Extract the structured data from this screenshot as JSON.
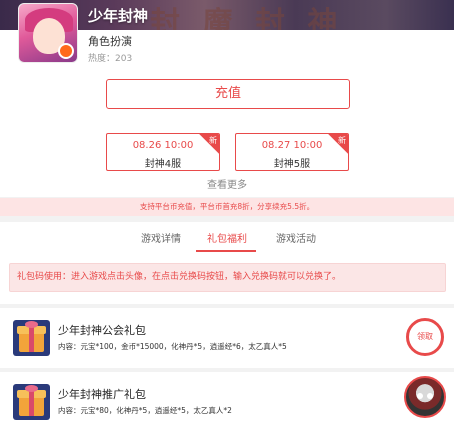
{
  "app": {
    "title": "少年封神",
    "genre": "角色扮演",
    "heat": "热度：203",
    "banner_deco": "封 魔 封 神"
  },
  "actions": {
    "recharge_label": "充值"
  },
  "servers": [
    {
      "time": "08.26 10:00",
      "name": "封神4服",
      "tag": "新"
    },
    {
      "time": "08.27 10:00",
      "name": "封神5服",
      "tag": "新"
    }
  ],
  "more_label": "查看更多",
  "notice": "支持平台币充值，平台币首充8折，分享续充5.5折。",
  "tabs": [
    {
      "label": "游戏详情",
      "active": false
    },
    {
      "label": "礼包福利",
      "active": true
    },
    {
      "label": "游戏活动",
      "active": false
    }
  ],
  "giftcode_tip": "礼包码使用：进入游戏点击头像，在点击兑换码按钮，输入兑换码就可以兑换了。",
  "gifts": [
    {
      "name": "少年封神公会礼包",
      "content": "内容：元宝*100，金币*15000，化神丹*5，逍遥经*6，太乙真人*5",
      "claim_label": "领取"
    },
    {
      "name": "少年封神推广礼包",
      "content": "内容：元宝*80，化神丹*5，逍遥经*5，太乙真人*2"
    }
  ],
  "colors": {
    "accent": "#e84a4a",
    "notice_bg": "#fde4e4"
  }
}
